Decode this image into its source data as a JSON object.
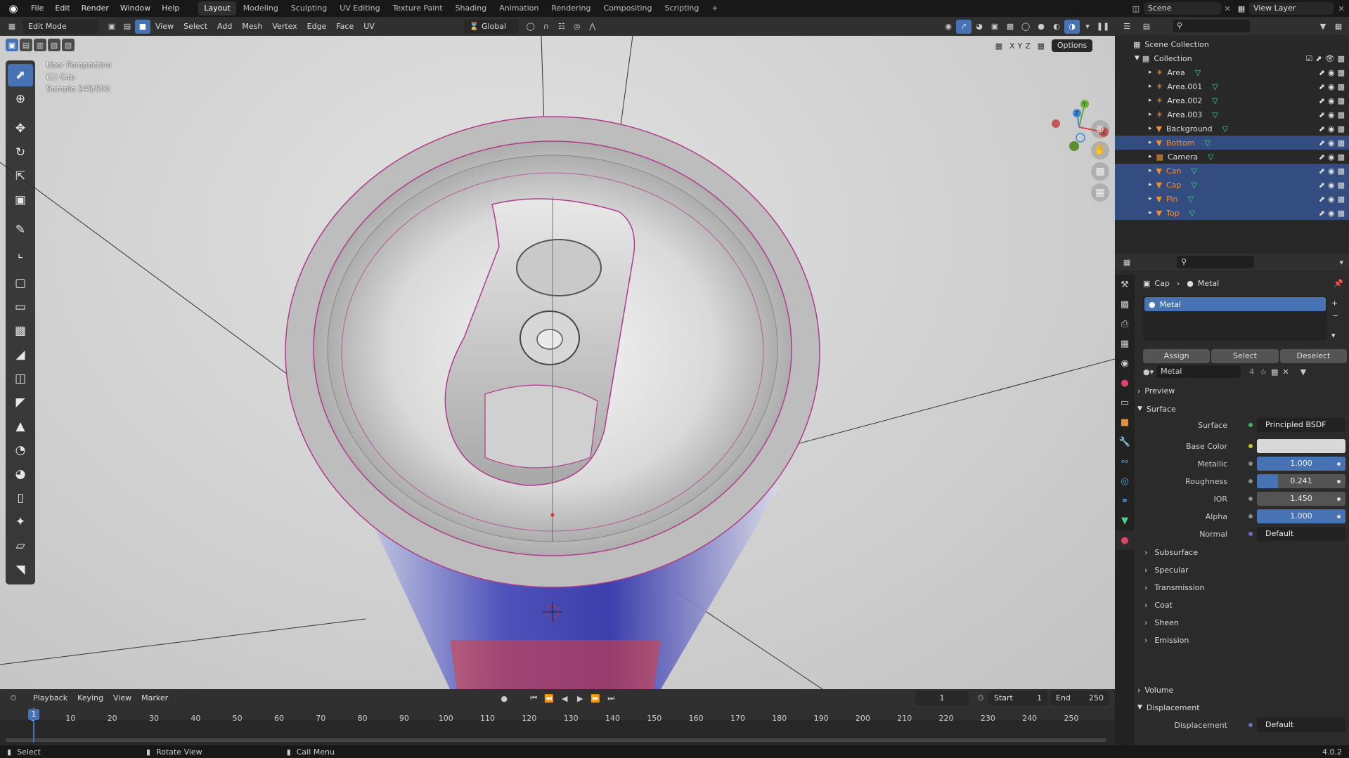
{
  "menu": {
    "file": "File",
    "edit": "Edit",
    "render": "Render",
    "window": "Window",
    "help": "Help"
  },
  "workspaces": [
    "Layout",
    "Modeling",
    "Sculpting",
    "UV Editing",
    "Texture Paint",
    "Shading",
    "Animation",
    "Rendering",
    "Compositing",
    "Scripting"
  ],
  "active_workspace": "Layout",
  "add_workspace": "+",
  "scene": {
    "label": "Scene",
    "view_layer": "View Layer"
  },
  "viewport_header": {
    "mode": "Edit Mode",
    "menus": [
      "View",
      "Select",
      "Add",
      "Mesh",
      "Vertex",
      "Edge",
      "Face",
      "UV"
    ],
    "orientation": "Global",
    "options": "Options",
    "axes": [
      "X",
      "Y",
      "Z"
    ]
  },
  "viewport_info": {
    "line1": "User Perspective",
    "line2": "(1) Cap",
    "line3": "Sample 245/500"
  },
  "outliner": {
    "root": "Scene Collection",
    "collection": "Collection",
    "items": [
      {
        "name": "Area",
        "type": "light",
        "selected": false
      },
      {
        "name": "Area.001",
        "type": "light",
        "selected": false
      },
      {
        "name": "Area.002",
        "type": "light",
        "selected": false
      },
      {
        "name": "Area.003",
        "type": "light",
        "selected": false
      },
      {
        "name": "Background",
        "type": "mesh",
        "selected": false
      },
      {
        "name": "Bottom",
        "type": "mesh",
        "selected": true
      },
      {
        "name": "Camera",
        "type": "camera",
        "selected": false
      },
      {
        "name": "Can",
        "type": "mesh",
        "selected": true
      },
      {
        "name": "Cap",
        "type": "mesh",
        "selected": true
      },
      {
        "name": "Pin",
        "type": "mesh",
        "selected": true
      },
      {
        "name": "Top",
        "type": "mesh",
        "selected": true
      }
    ]
  },
  "properties": {
    "breadcrumb_object": "Cap",
    "breadcrumb_material": "Metal",
    "slot_name": "Metal",
    "assign": "Assign",
    "select": "Select",
    "deselect": "Deselect",
    "material_name": "Metal",
    "user_count": "4",
    "preview": "Preview",
    "surface_header": "Surface",
    "surface_label": "Surface",
    "surface_value": "Principled BSDF",
    "base_color_label": "Base Color",
    "base_color": "#d8d8d8",
    "metallic_label": "Metallic",
    "metallic": "1.000",
    "metallic_fraction": 1.0,
    "roughness_label": "Roughness",
    "roughness": "0.241",
    "roughness_fraction": 0.241,
    "ior_label": "IOR",
    "ior": "1.450",
    "alpha_label": "Alpha",
    "alpha": "1.000",
    "alpha_fraction": 1.0,
    "normal_label": "Normal",
    "normal_value": "Default",
    "subpanels": [
      "Subsurface",
      "Specular",
      "Transmission",
      "Coat",
      "Sheen",
      "Emission"
    ],
    "volume": "Volume",
    "displacement_header": "Displacement",
    "displacement_label": "Displacement",
    "displacement_value": "Default"
  },
  "timeline": {
    "menus": [
      "Playback",
      "Keying",
      "View",
      "Marker"
    ],
    "current_frame": "1",
    "start_label": "Start",
    "start": "1",
    "end_label": "End",
    "end": "250",
    "ticks": [
      "1",
      "10",
      "20",
      "30",
      "40",
      "50",
      "60",
      "70",
      "80",
      "90",
      "100",
      "110",
      "120",
      "130",
      "140",
      "150",
      "160",
      "170",
      "180",
      "190",
      "200",
      "210",
      "220",
      "230",
      "240",
      "250"
    ]
  },
  "statusbar": {
    "select": "Select",
    "rotate": "Rotate View",
    "call_menu": "Call Menu",
    "version": "4.0.2"
  },
  "colors": {
    "accent": "#4772b3",
    "selected_text": "#ff8c2b",
    "wire": "#b03a8c"
  }
}
